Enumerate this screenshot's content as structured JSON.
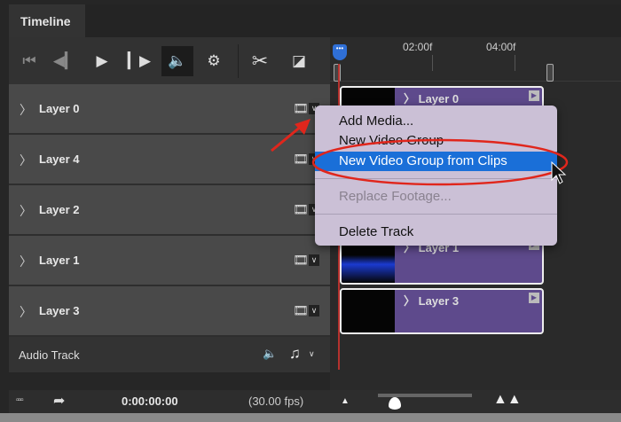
{
  "panel": {
    "tab": "Timeline"
  },
  "ruler": {
    "ticks": [
      "02:00f",
      "04:00f"
    ]
  },
  "layers": [
    {
      "label": "Layer 0"
    },
    {
      "label": "Layer 4"
    },
    {
      "label": "Layer 2"
    },
    {
      "label": "Layer 1"
    },
    {
      "label": "Layer 3"
    }
  ],
  "clips": {
    "c0": "Layer 0",
    "c1": "Layer 1",
    "c3": "Layer 3"
  },
  "audio": {
    "label": "Audio Track"
  },
  "menu": {
    "items": [
      "Add Media...",
      "New Video Group",
      "New Video Group from Clips",
      "Replace Footage...",
      "Delete Track"
    ],
    "highlight_color": "#1a6fd8"
  },
  "footer": {
    "timecode": "0:00:00:00",
    "fps": "(30.00 fps)"
  },
  "colors": {
    "clip": "#5e4a8c",
    "annotation": "#e0261c"
  }
}
